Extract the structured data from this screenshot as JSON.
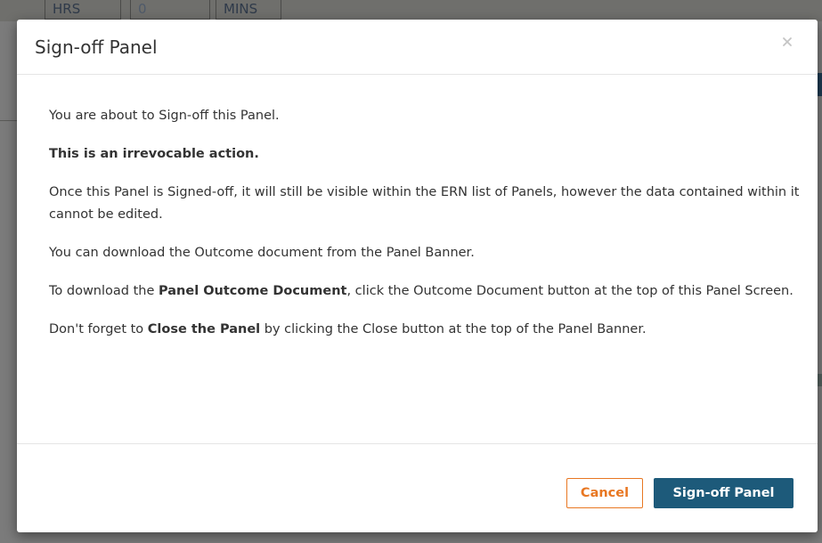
{
  "background": {
    "chips": [
      "HRS",
      "0",
      "MINS"
    ]
  },
  "modal": {
    "title": "Sign-off Panel",
    "close_icon": "close-icon",
    "body": {
      "p1": "You are about to Sign-off this Panel.",
      "p2_bold": "This is an irrevocable action.",
      "p3": "Once this Panel is Signed-off, it will still be visible within the ERN list of Panels, however the data contained within it cannot be edited.",
      "p4": "You can download the Outcome document from the Panel Banner.",
      "p5_pre": "To download the ",
      "p5_bold": "Panel Outcome Document",
      "p5_post": ", click the Outcome Document button at the top of this Panel Screen.",
      "p6_pre": "Don't forget to ",
      "p6_bold": "Close the Panel",
      "p6_post": " by clicking the Close button at the top of the Panel Banner."
    },
    "footer": {
      "cancel_label": "Cancel",
      "signoff_label": "Sign-off Panel"
    }
  },
  "colors": {
    "overlay": "#7b7b7b",
    "accent_orange": "#e87722",
    "primary_blue": "#1d5a7a"
  }
}
